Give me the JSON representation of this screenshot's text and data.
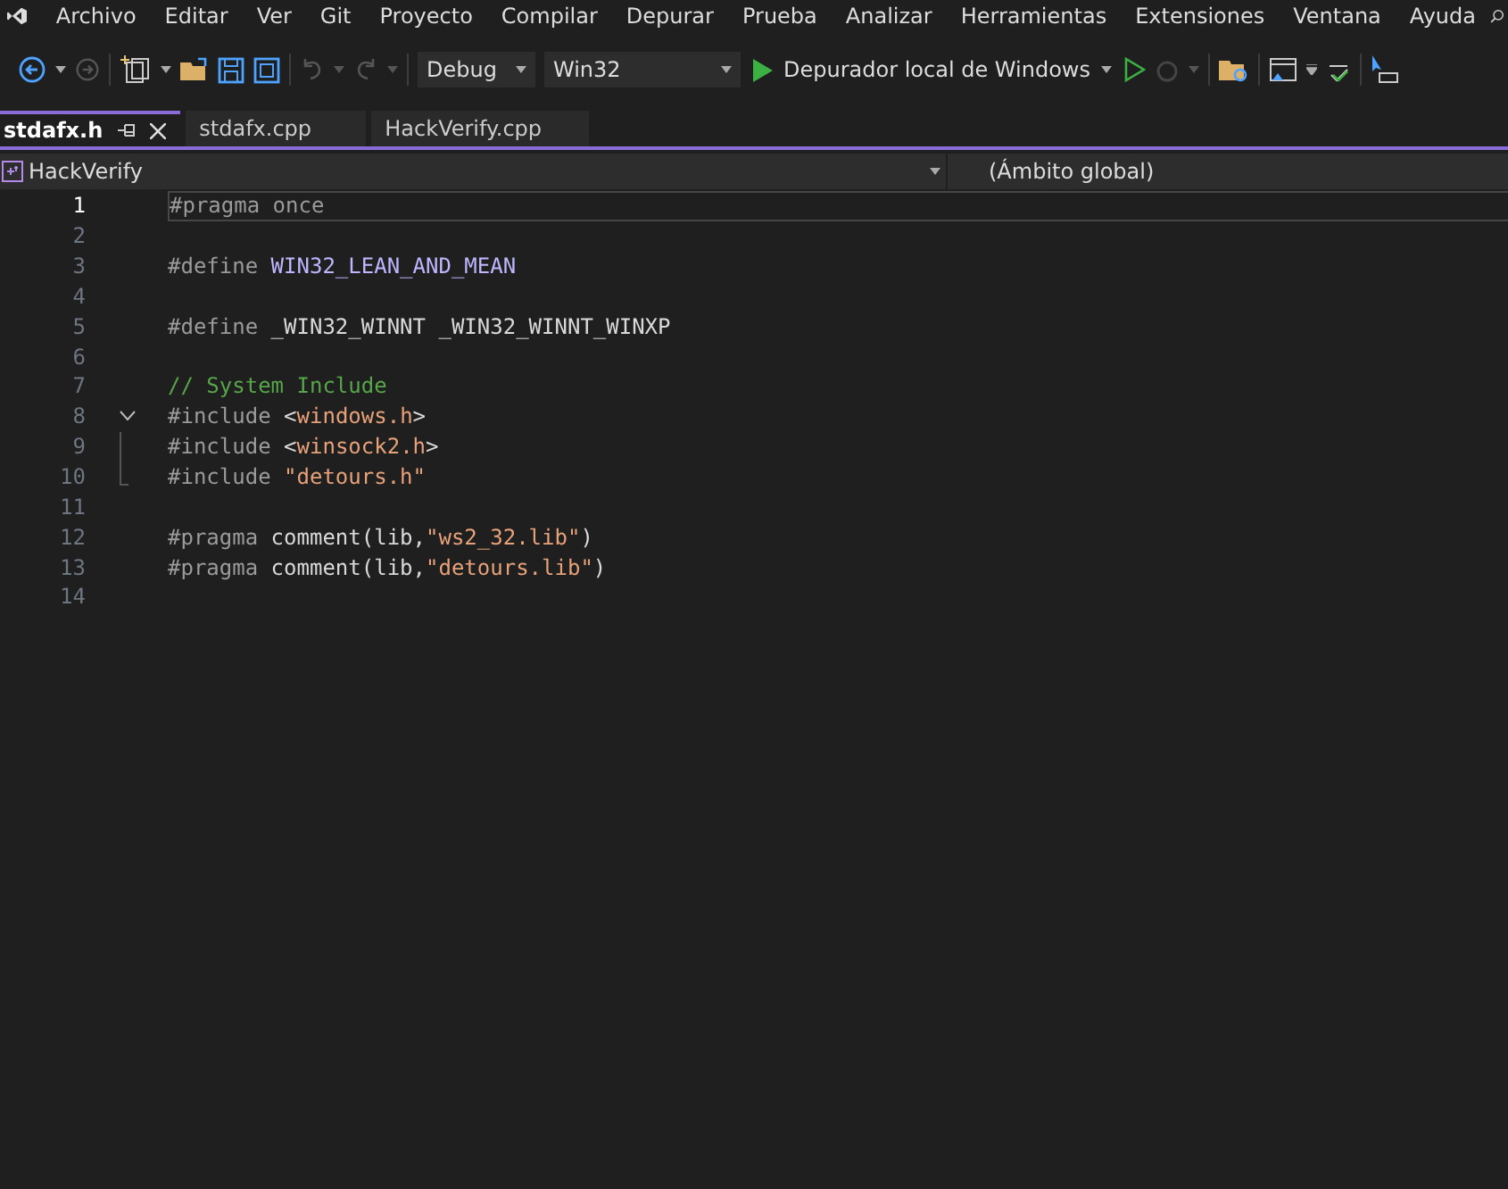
{
  "menu": [
    "Archivo",
    "Editar",
    "Ver",
    "Git",
    "Proyecto",
    "Compilar",
    "Depurar",
    "Prueba",
    "Analizar",
    "Herramientas",
    "Extensiones",
    "Ventana",
    "Ayuda"
  ],
  "toolbar": {
    "configuration": "Debug",
    "platform": "Win32",
    "run": "Depurador local de Windows"
  },
  "tabs": [
    {
      "label": "stdafx.h",
      "selected": true
    },
    {
      "label": "stdafx.cpp",
      "selected": false
    },
    {
      "label": "HackVerify.cpp",
      "selected": false
    }
  ],
  "navigation": {
    "project": "HackVerify",
    "scope": "(Ámbito global)"
  },
  "editor": {
    "lines": [
      {
        "number": "1",
        "current": true,
        "tokens": [
          {
            "kind": "directive",
            "text": "#pragma once"
          }
        ]
      },
      {
        "number": "2",
        "current": false
      },
      {
        "number": "3",
        "current": false,
        "tokens": [
          {
            "kind": "directive",
            "text": "#define "
          },
          {
            "kind": "macro",
            "text": "WIN32_LEAN_AND_MEAN"
          }
        ]
      },
      {
        "number": "4",
        "current": false
      },
      {
        "number": "5",
        "current": false,
        "tokens": [
          {
            "kind": "directive",
            "text": "#define "
          },
          {
            "kind": "text",
            "text": "_WIN32_WINNT _WIN32_WINNT_WINXP"
          }
        ]
      },
      {
        "number": "6",
        "current": false
      },
      {
        "number": "7",
        "current": false,
        "tokens": [
          {
            "kind": "comment",
            "text": "// System Include"
          }
        ]
      },
      {
        "number": "8",
        "current": false,
        "expanded": true,
        "tokens": [
          {
            "kind": "directive",
            "text": "#include "
          },
          {
            "kind": "text",
            "text": "<"
          },
          {
            "kind": "string",
            "text": "windows.h"
          },
          {
            "kind": "text",
            "text": ">"
          }
        ],
        "children": [
          {
            "number": "9",
            "current": false,
            "tokens": [
              {
                "kind": "directive",
                "text": "#include "
              },
              {
                "kind": "text",
                "text": "<"
              },
              {
                "kind": "string",
                "text": "winsock2.h"
              },
              {
                "kind": "text",
                "text": ">"
              }
            ]
          },
          {
            "number": "10",
            "current": false,
            "tokens": [
              {
                "kind": "directive",
                "text": "#include "
              },
              {
                "kind": "string",
                "text": "\"detours.h\""
              }
            ]
          }
        ]
      },
      {
        "number": "11",
        "current": false
      },
      {
        "number": "12",
        "current": false,
        "tokens": [
          {
            "kind": "directive",
            "text": "#pragma "
          },
          {
            "kind": "text",
            "text": "comment(lib,"
          },
          {
            "kind": "string",
            "text": "\"ws2_32.lib\""
          },
          {
            "kind": "text",
            "text": ")"
          }
        ]
      },
      {
        "number": "13",
        "current": false,
        "tokens": [
          {
            "kind": "directive",
            "text": "#pragma "
          },
          {
            "kind": "text",
            "text": "comment(lib,"
          },
          {
            "kind": "string",
            "text": "\"detours.lib\""
          },
          {
            "kind": "text",
            "text": ")"
          }
        ]
      },
      {
        "number": "14",
        "current": false
      }
    ]
  }
}
